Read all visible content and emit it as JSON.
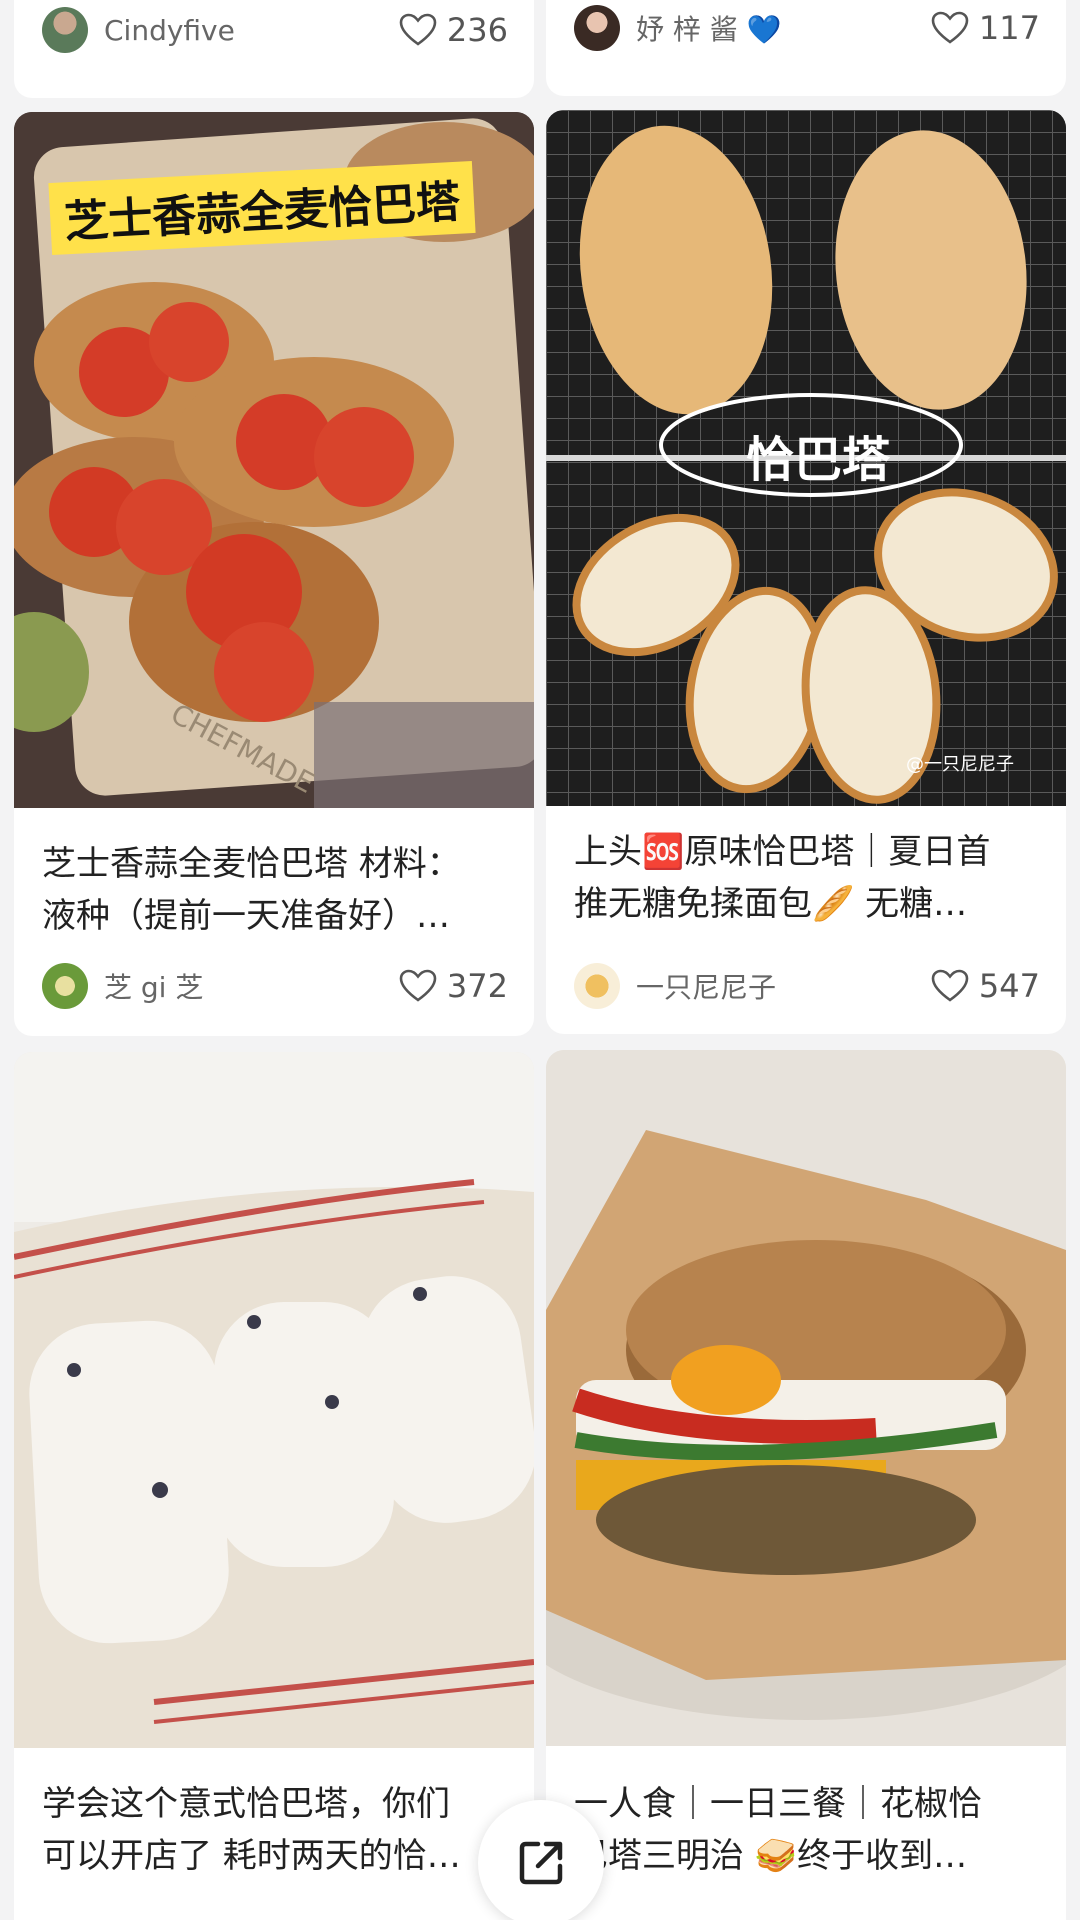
{
  "colors": {
    "background": "#f3f3f4",
    "card": "#ffffff",
    "text": "#222222",
    "muted": "#666666"
  },
  "feed": {
    "top_row": [
      {
        "author": "Cindyfive",
        "likes": "236"
      },
      {
        "author": "妤 梓 酱 💙",
        "likes": "117"
      }
    ],
    "posts": [
      {
        "image_icon": "pizza-bread-photo",
        "image_caption": "芝士香蒜全麦恰巴塔",
        "image_watermark": "CHEFMADE",
        "title_line1": "芝士香蒜全麦恰巴塔 材料：",
        "title_line2": "液种（提前一天准备好）…",
        "author": "芝 gi 芝",
        "likes": "372"
      },
      {
        "image_icon": "ciabatta-bread-photo",
        "image_caption": "恰巴塔",
        "image_watermark": "@一只尼尼子",
        "title_line1": "上头🆘原味恰巴塔｜夏日首",
        "title_line2": "推无糖免揉面包🥖 无糖…",
        "author": "一只尼尼子",
        "likes": "547"
      },
      {
        "image_icon": "dough-on-towel-photo",
        "title_line1": "学会这个意式恰巴塔，你们",
        "title_line2": "可以开店了 耗时两天的恰…"
      },
      {
        "image_icon": "sandwich-photo",
        "title_line1": "一人食｜一日三餐｜花椒恰",
        "title_line2": "巴塔三明治 🥪终于收到…"
      }
    ]
  },
  "share_button_icon": "share-external-icon"
}
